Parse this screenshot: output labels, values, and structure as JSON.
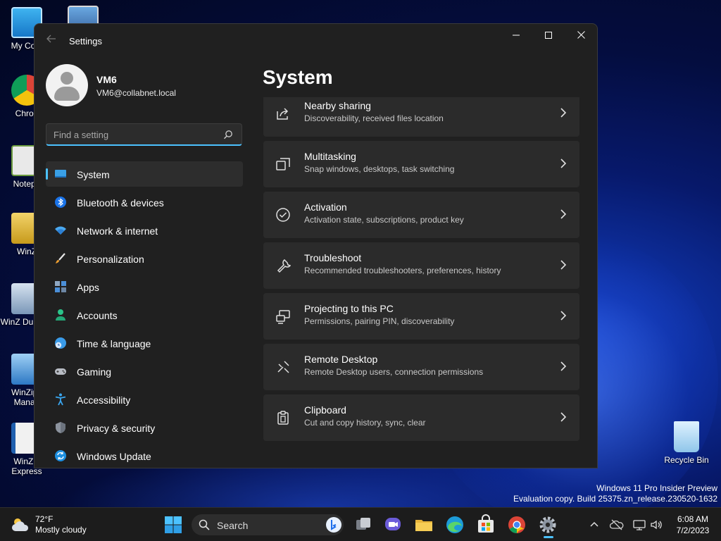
{
  "desktop": {
    "icons": [
      {
        "label": "My Com"
      },
      {
        "label": "Chron"
      },
      {
        "label": "Notepa"
      },
      {
        "label": "WinZ"
      },
      {
        "label": "WinZ Duplicat"
      },
      {
        "label": "WinZip I Manag"
      },
      {
        "label": "WinZip Express"
      },
      {
        "label": "Recycle Bin"
      }
    ],
    "watermark": {
      "line1": "Windows 11 Pro Insider Preview",
      "line2": "Evaluation copy. Build 25375.zn_release.230520-1632"
    }
  },
  "window": {
    "title": "Settings",
    "controls": {
      "minimize": "—",
      "maximize": "☐",
      "close": "✕"
    }
  },
  "profile": {
    "name": "VM6",
    "email": "VM6@collabnet.local"
  },
  "search": {
    "placeholder": "Find a setting"
  },
  "nav": [
    {
      "label": "System",
      "icon": "system-icon",
      "active": true
    },
    {
      "label": "Bluetooth & devices",
      "icon": "bluetooth-icon"
    },
    {
      "label": "Network & internet",
      "icon": "wifi-icon"
    },
    {
      "label": "Personalization",
      "icon": "brush-icon"
    },
    {
      "label": "Apps",
      "icon": "apps-icon"
    },
    {
      "label": "Accounts",
      "icon": "account-icon"
    },
    {
      "label": "Time & language",
      "icon": "globe-clock-icon"
    },
    {
      "label": "Gaming",
      "icon": "gamepad-icon"
    },
    {
      "label": "Accessibility",
      "icon": "accessibility-icon"
    },
    {
      "label": "Privacy & security",
      "icon": "shield-icon"
    },
    {
      "label": "Windows Update",
      "icon": "update-icon"
    }
  ],
  "content": {
    "title": "System",
    "cards": [
      {
        "title": "Nearby sharing",
        "subtitle": "Discoverability, received files location",
        "icon": "share-icon"
      },
      {
        "title": "Multitasking",
        "subtitle": "Snap windows, desktops, task switching",
        "icon": "multitask-icon"
      },
      {
        "title": "Activation",
        "subtitle": "Activation state, subscriptions, product key",
        "icon": "check-circle-icon"
      },
      {
        "title": "Troubleshoot",
        "subtitle": "Recommended troubleshooters, preferences, history",
        "icon": "wrench-icon"
      },
      {
        "title": "Projecting to this PC",
        "subtitle": "Permissions, pairing PIN, discoverability",
        "icon": "projector-icon"
      },
      {
        "title": "Remote Desktop",
        "subtitle": "Remote Desktop users, connection permissions",
        "icon": "remote-icon"
      },
      {
        "title": "Clipboard",
        "subtitle": "Cut and copy history, sync, clear",
        "icon": "clipboard-icon"
      }
    ]
  },
  "taskbar": {
    "weather": {
      "temp": "72°F",
      "desc": "Mostly cloudy"
    },
    "search_label": "Search",
    "clock": {
      "time": "6:08 AM",
      "date": "7/2/2023"
    }
  },
  "colors": {
    "accent": "#4cc2ff",
    "window_bg": "#202020",
    "card_bg": "#2b2b2b"
  }
}
